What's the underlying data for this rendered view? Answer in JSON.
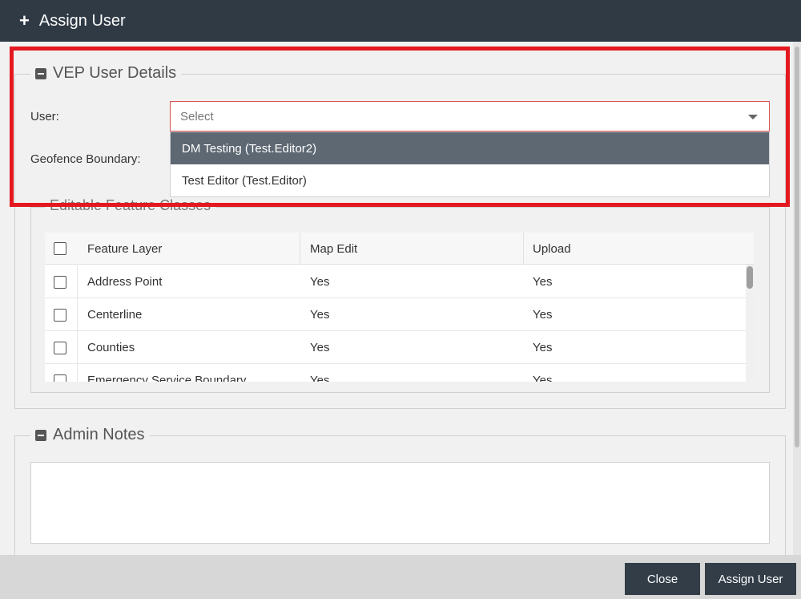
{
  "dialog": {
    "title": "Assign User"
  },
  "vep_section": {
    "legend": "VEP User Details",
    "user_label": "User:",
    "geofence_label": "Geofence Boundary:",
    "user_select": {
      "placeholder": "Select"
    },
    "dropdown_options": [
      {
        "label": "DM Testing (Test.Editor2)",
        "highlighted": true
      },
      {
        "label": "Test Editor (Test.Editor)",
        "highlighted": false
      }
    ]
  },
  "feature_section": {
    "legend": "Editable Feature Classes",
    "columns": [
      "Feature Layer",
      "Map Edit",
      "Upload"
    ],
    "rows": [
      {
        "layer": "Address Point",
        "map_edit": "Yes",
        "upload": "Yes"
      },
      {
        "layer": "Centerline",
        "map_edit": "Yes",
        "upload": "Yes"
      },
      {
        "layer": "Counties",
        "map_edit": "Yes",
        "upload": "Yes"
      },
      {
        "layer": "Emergency Service Boundary",
        "map_edit": "Yes",
        "upload": "Yes"
      }
    ]
  },
  "notes_section": {
    "legend": "Admin Notes"
  },
  "footer": {
    "close_label": "Close",
    "assign_label": "Assign User"
  },
  "colors": {
    "titlebar": "#2f3a45",
    "highlight_border": "#e4191f",
    "selected_option": "#5d6873",
    "button": "#323d48"
  }
}
